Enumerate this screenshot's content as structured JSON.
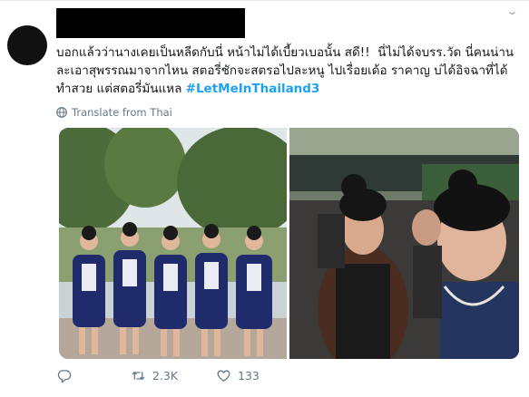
{
  "tweet": {
    "text_before": "บอกแล้วว่านางเคยเป็นหลีดกับนี่ หน้าไม่ได้เบี้ยวเบอนั้น สดี!!  นี่ไม่ได้จบรร.วัด นี่คนน่าน ละเอาสุพรรณมาจากไหน สตอรี่ชักจะสตรอไปละหนู ไปเรื่อยเด้อ ราคาญ บ่ได้อิจฉาที่ได้ทำสวย แต่สตอรี่มันแหล ",
    "hashtag": "#LetMeInThailand3",
    "translate_label": "Translate from Thai"
  },
  "actions": {
    "reply_count": "",
    "retweet_count": "2.3K",
    "like_count": "133"
  },
  "colors": {
    "link": "#1da1f2",
    "muted": "#657786",
    "redaction": "#000000"
  },
  "icons": [
    "chevron-down-icon",
    "globe-icon",
    "reply-icon",
    "retweet-icon",
    "heart-icon"
  ]
}
